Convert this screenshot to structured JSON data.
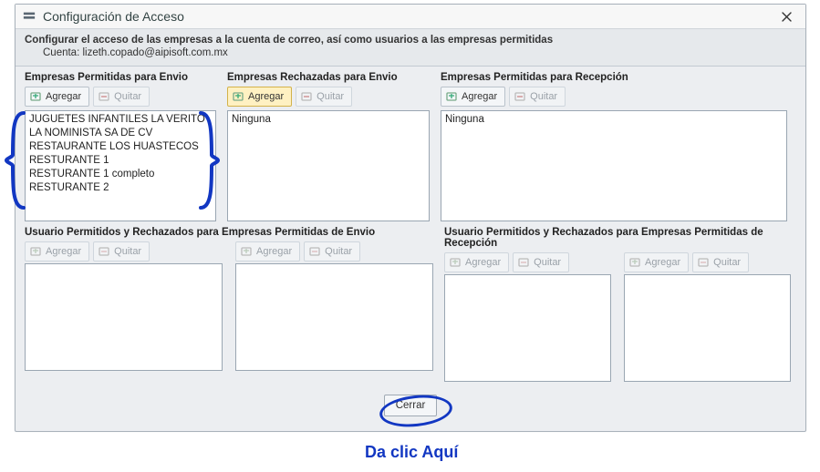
{
  "window": {
    "title": "Configuración de Acceso",
    "close_icon": "✕"
  },
  "infobar": {
    "instruction": "Configurar el acceso de las empresas a la cuenta de correo, así como usuarios a las empresas permitidas",
    "account_label": "Cuenta:",
    "account_value": "lizeth.copado@aipisoft.com.mx"
  },
  "buttons": {
    "add": "Agregar",
    "remove": "Quitar",
    "close": "Cerrar"
  },
  "top_panels": {
    "allowed_send": {
      "title": "Empresas Permitidas para Envio",
      "items": [
        "JUGUETES INFANTILES LA VERITO",
        "LA NOMINISTA SA DE CV",
        "RESTAURANTE LOS HUASTECOS",
        "RESTURANTE 1",
        "RESTURANTE 1 completo",
        "RESTURANTE 2"
      ]
    },
    "rejected_send": {
      "title": "Empresas Rechazadas para Envio",
      "items": [
        "Ninguna"
      ]
    },
    "allowed_receive": {
      "title": "Empresas Permitidas para Recepción",
      "items": [
        "Ninguna"
      ]
    }
  },
  "bottom_groups": {
    "left": {
      "title": "Usuario Permitidos y Rechazados para Empresas Permitidas de Envio"
    },
    "right": {
      "title": "Usuario Permitidos y Rechazados para Empresas Permitidas de Recepción"
    }
  },
  "annotation": {
    "callout": "Da clic Aquí"
  }
}
